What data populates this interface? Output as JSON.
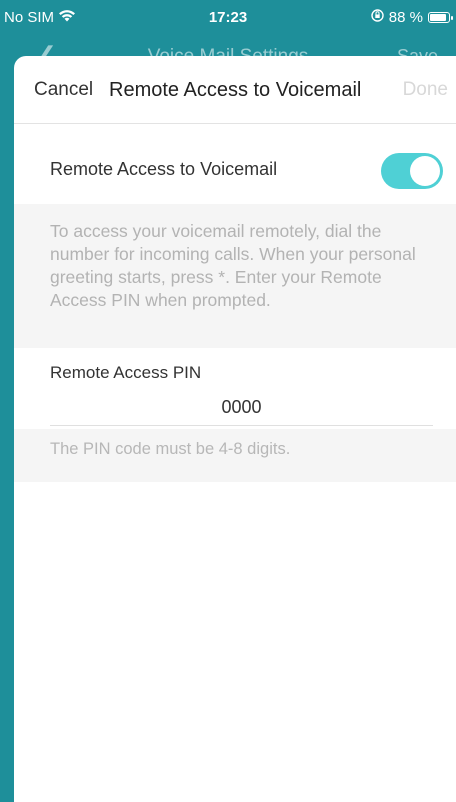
{
  "status_bar": {
    "carrier": "No SIM",
    "wifi_icon": "wifi-icon",
    "time": "17:23",
    "orientation_lock_icon": "orientation-lock-icon",
    "battery_percent": "88 %",
    "battery_level": 0.88
  },
  "background_nav": {
    "back_icon": "chevron-left-icon",
    "title": "Voice Mail Settings",
    "save_label": "Save"
  },
  "sheet": {
    "cancel_label": "Cancel",
    "title": "Remote Access to Voicemail",
    "done_label": "Done",
    "toggle_label": "Remote Access to Voicemail",
    "toggle_on": true,
    "toggle_color": "#4fd0d5",
    "info_text": "To access your voicemail remotely, dial the number for incoming calls. When your personal greeting starts, press *. Enter your Remote Access PIN when prompted.",
    "pin_label": "Remote Access PIN",
    "pin_value": "0000",
    "pin_hint": "The PIN code must be 4-8 digits."
  },
  "colors": {
    "accent": "#1e8f9a",
    "disabled": "#d8d8d8",
    "muted_text": "#b3b3b3"
  }
}
